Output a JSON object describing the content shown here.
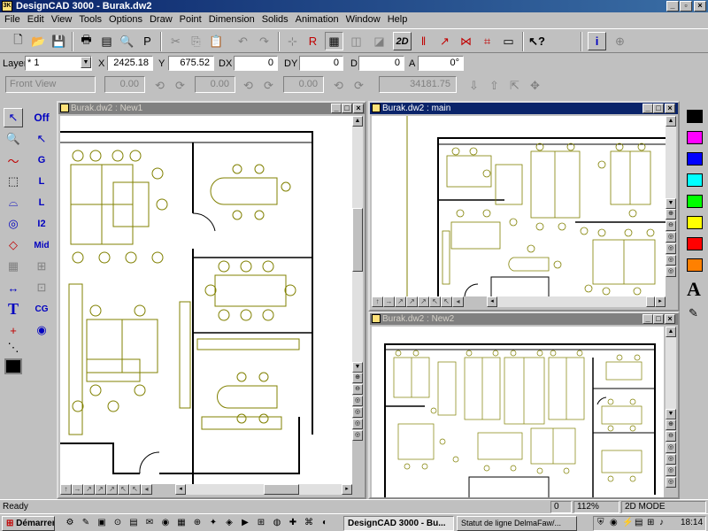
{
  "app": {
    "title": "DesignCAD 3000 - Burak.dw2",
    "icon_text": "3K"
  },
  "menu": [
    "File",
    "Edit",
    "View",
    "Tools",
    "Options",
    "Draw",
    "Point",
    "Dimension",
    "Solids",
    "Animation",
    "Window",
    "Help"
  ],
  "toolbar": {
    "button_2d": "2D"
  },
  "coords": {
    "layer_label": "Layer",
    "layer_value": "* 1",
    "x_label": "X",
    "x_value": "2425.18",
    "y_label": "Y",
    "y_value": "675.52",
    "dx_label": "DX",
    "dx_value": "0",
    "dy_label": "DY",
    "dy_value": "0",
    "d_label": "D",
    "d_value": "0",
    "a_label": "A",
    "a_value": "0°"
  },
  "viewbar": {
    "view_select": "Front View",
    "field1": "0.00",
    "field2": "0.00",
    "field3": "0.00",
    "field4": "34181.75"
  },
  "lefttools": {
    "off_label": "Off",
    "g_label": "G",
    "l_label": "L",
    "l2_label": "L",
    "i2_label": "I2",
    "mid_label": "Mid",
    "cg_label": "CG",
    "t_label": "T"
  },
  "windows": {
    "new1": "Burak.dw2 : New1",
    "main": "Burak.dw2 : main",
    "new2": "Burak.dw2 : New2"
  },
  "palette": {
    "colors": [
      "#000000",
      "#ff00ff",
      "#0000ff",
      "#00ffff",
      "#00ff00",
      "#ffff00",
      "#ff0000",
      "#ff8000"
    ],
    "text_tool": "A"
  },
  "status": {
    "ready": "Ready",
    "value": "0",
    "zoom": "112%",
    "mode": "2D MODE"
  },
  "taskbar": {
    "start": "Démarrer",
    "task1": "DesignCAD 3000 - Bu...",
    "task2": "Statut de ligne DelmaFaw/...",
    "clock": "18:14"
  },
  "accent_color": "#0a246a",
  "drawing_color": "#808000"
}
